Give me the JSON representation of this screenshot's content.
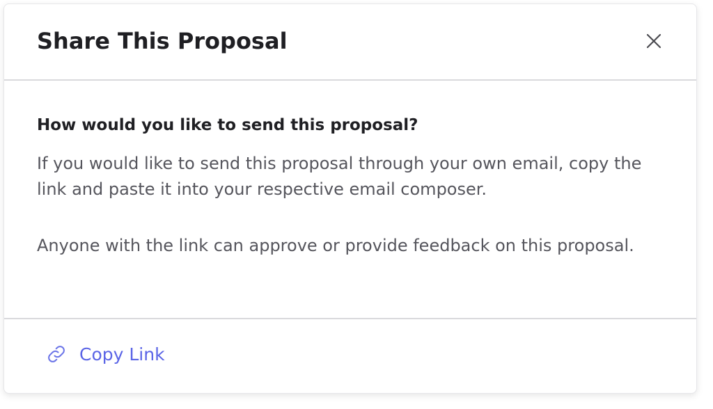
{
  "modal": {
    "title": "Share This Proposal",
    "close_icon": "close-icon"
  },
  "body": {
    "question": "How would you like to send this proposal?",
    "paragraph_1": "If you would like to send this proposal through your own email, copy the link and paste it into your respective email composer.",
    "paragraph_2": "Anyone with the link can approve or provide feedback on this proposal."
  },
  "footer": {
    "copy_link_label": "Copy Link",
    "copy_link_icon": "link-icon"
  },
  "colors": {
    "accent": "#5a64e6",
    "title": "#1f1f23",
    "body_text": "#55555c",
    "divider": "#d9d9dc"
  }
}
